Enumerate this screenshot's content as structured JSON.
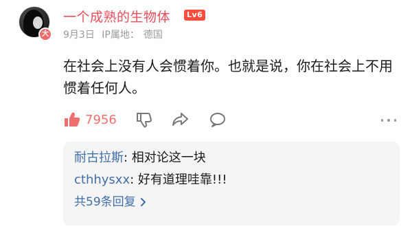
{
  "post": {
    "username": "一个成熟的生物体",
    "level": "Lv6",
    "avatar_badge": "大",
    "date": "9月3日",
    "ip_label": "IP属地：",
    "ip_location": "德国",
    "content": "在社会上没有人会惯着你。也就是说，你在社会上不用惯着任何人。"
  },
  "actions": {
    "like_count": "7956",
    "icons": [
      "thumbs-up-icon",
      "thumbs-down-icon",
      "share-icon",
      "comment-icon",
      "more-icon"
    ]
  },
  "replies": {
    "items": [
      {
        "name": "耐古拉斯",
        "sep": ": ",
        "text": "相对论这一块"
      },
      {
        "name": "cthhysxx",
        "sep": ": ",
        "text": "好有道理哇靠!!!"
      }
    ],
    "more_label": "共59条回复"
  },
  "colors": {
    "username": "#e8505b",
    "level_badge": "#ff4d3d",
    "like": "#ef6f6f",
    "reply_name": "#3f6ea8",
    "reply_bg": "#f5f5f5"
  }
}
